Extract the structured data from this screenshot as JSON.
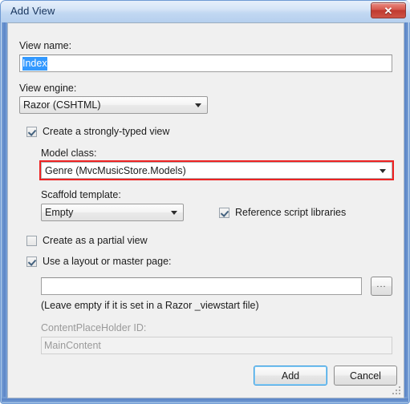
{
  "window": {
    "title": "Add View",
    "close_icon": "close-icon",
    "close_glyph": "✕"
  },
  "form": {
    "view_name_label": "View name:",
    "view_name_value": "Index",
    "view_engine_label": "View engine:",
    "view_engine_value": "Razor (CSHTML)",
    "strongly_typed_label": "Create a strongly-typed view",
    "strongly_typed_checked": true,
    "model_class_label": "Model class:",
    "model_class_value": "Genre (MvcMusicStore.Models)",
    "model_class_highlight_color": "#ee2222",
    "scaffold_label": "Scaffold template:",
    "scaffold_value": "Empty",
    "reference_scripts_label": "Reference script libraries",
    "reference_scripts_checked": true,
    "partial_view_label": "Create as a partial view",
    "partial_view_checked": false,
    "layout_page_label": "Use a layout or master page:",
    "layout_page_checked": true,
    "layout_path_value": "",
    "layout_path_placeholder": "",
    "browse_label": "...",
    "leave_empty_hint": "(Leave empty if it is set in a Razor _viewstart file)",
    "content_placeholder_label": "ContentPlaceHolder ID:",
    "content_placeholder_value": "MainContent"
  },
  "footer": {
    "add_label": "Add",
    "cancel_label": "Cancel"
  }
}
